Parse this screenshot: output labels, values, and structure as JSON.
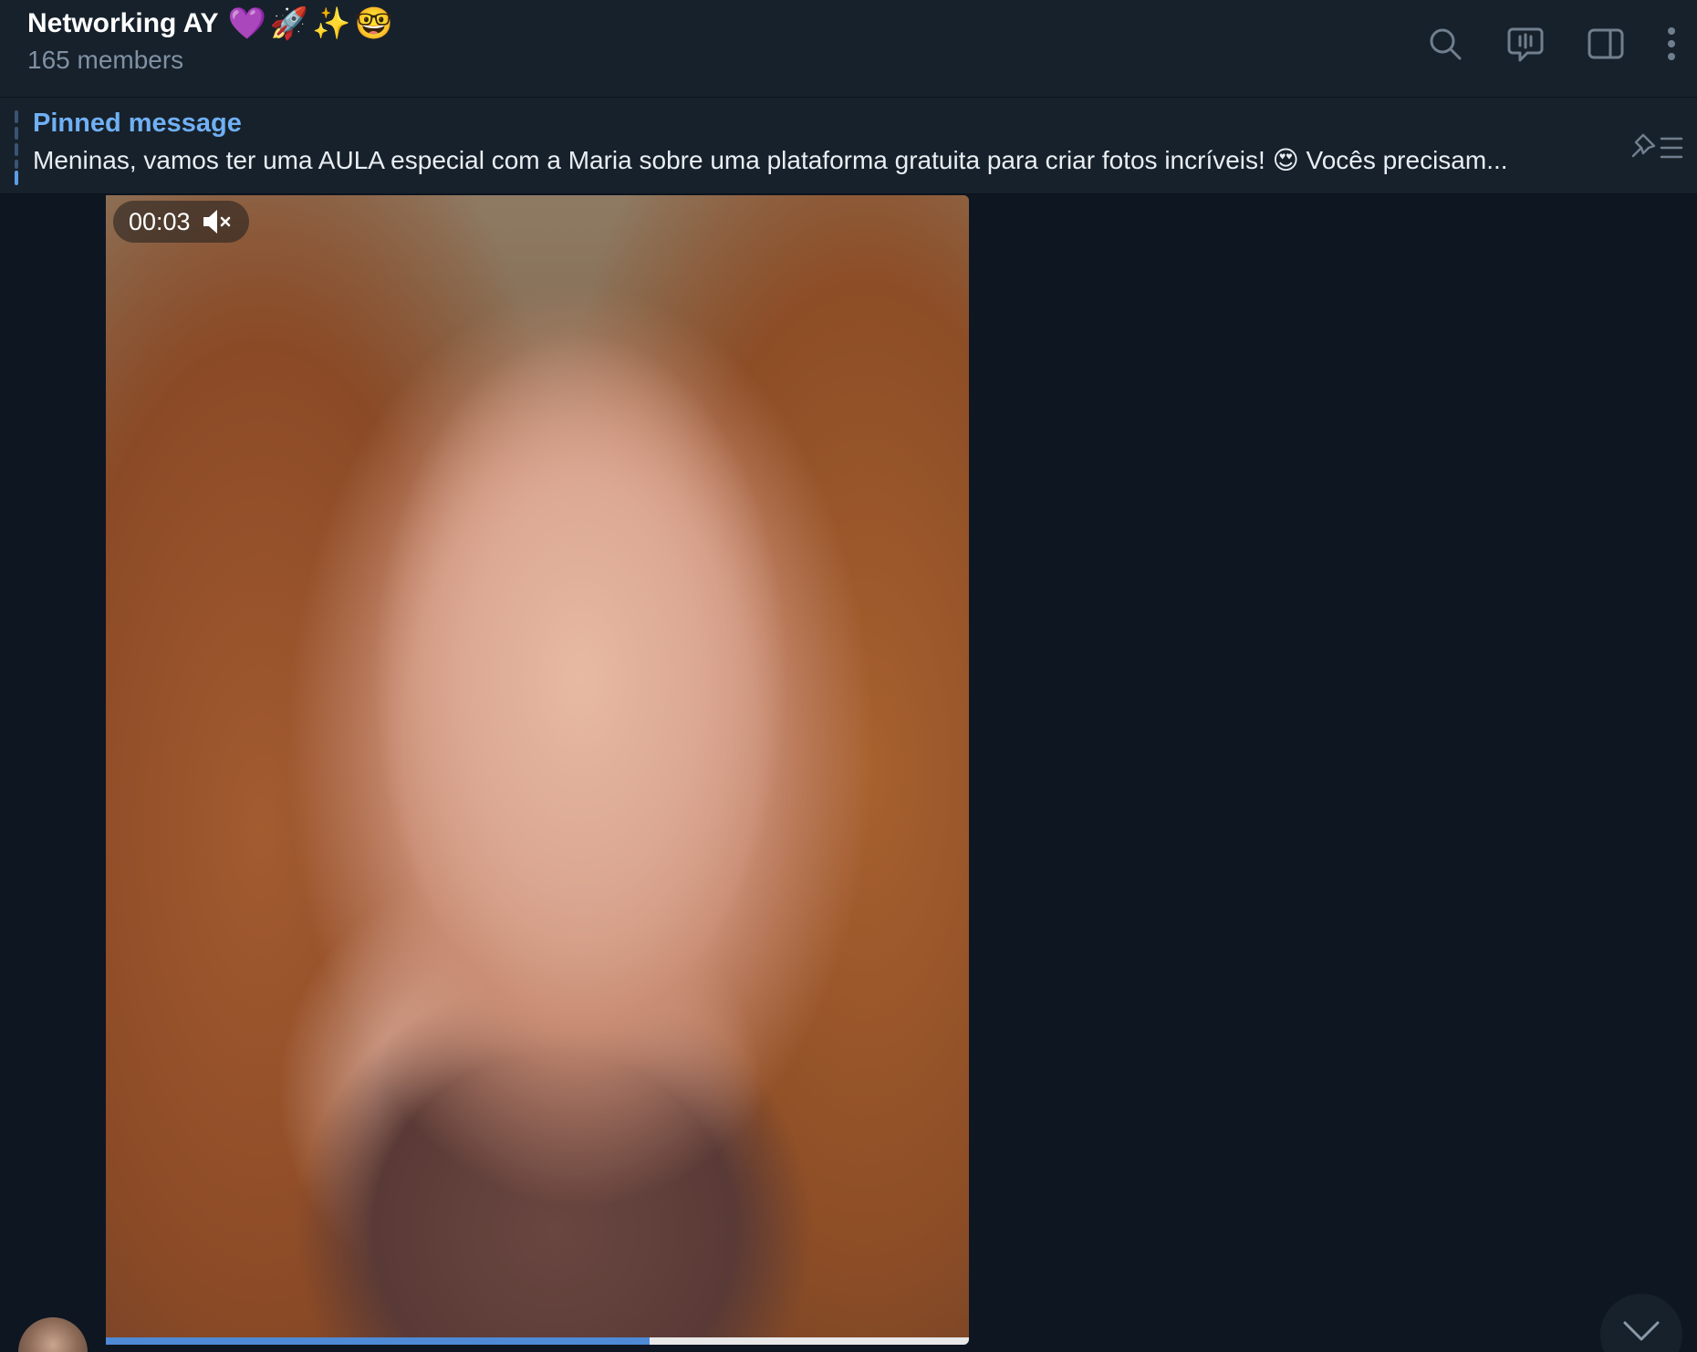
{
  "header": {
    "title": "Networking AY",
    "title_emojis": "💜🚀✨🤓",
    "subtitle": "165 members",
    "actions": [
      {
        "icon": "search-icon"
      },
      {
        "icon": "video-chat-icon"
      },
      {
        "icon": "sidebar-toggle-icon"
      },
      {
        "icon": "more-vertical-icon"
      }
    ]
  },
  "pinned": {
    "label": "Pinned message",
    "text": "Meninas, vamos ter uma AULA especial com a Maria  sobre uma plataforma gratuita para criar fotos incríveis! 😍  Vocês precisam...",
    "icon": "pinned-list-icon"
  },
  "video": {
    "duration": "00:03",
    "muted": true,
    "progress": 0.63,
    "progress_color": "#4f8ad6"
  },
  "colors": {
    "background": "#0e1621",
    "header_bg": "#17212b",
    "accent": "#70b0f4",
    "muted_text": "#7f91a4"
  }
}
